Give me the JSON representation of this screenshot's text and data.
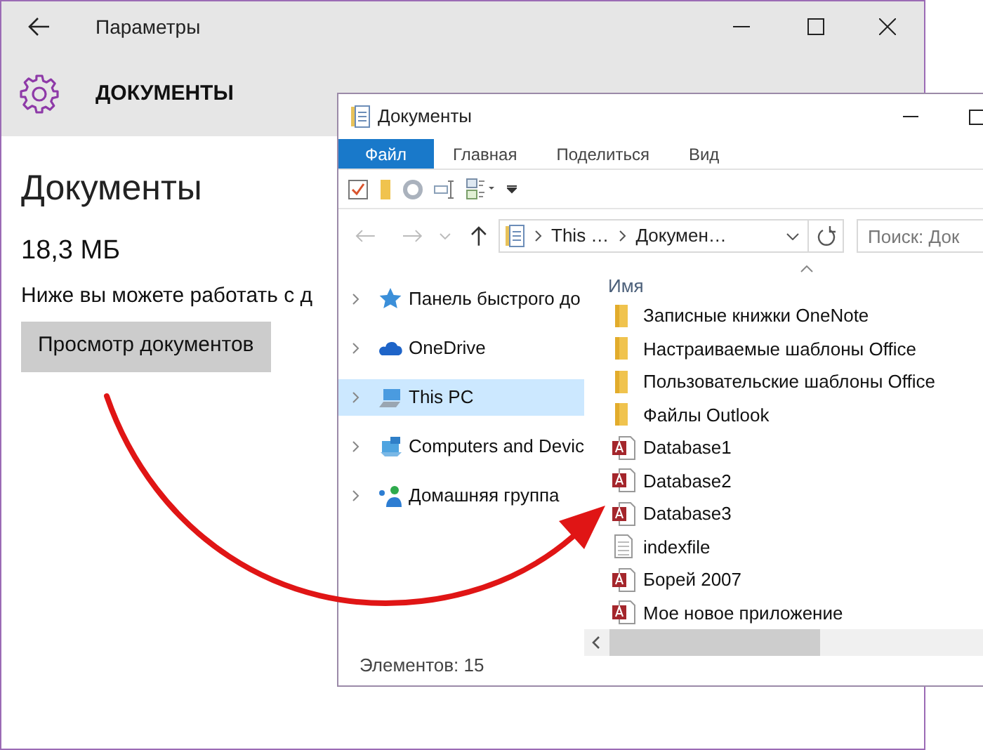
{
  "settings": {
    "title": "Параметры",
    "header": "ДОКУМЕНТЫ",
    "heading": "Документы",
    "size": "18,3 МБ",
    "description": "Ниже вы можете работать с д",
    "button": "Просмотр документов"
  },
  "explorer": {
    "title": "Документы",
    "ribbon_tabs": [
      {
        "label": "Файл",
        "selected": true
      },
      {
        "label": "Главная",
        "selected": false
      },
      {
        "label": "Поделиться",
        "selected": false
      },
      {
        "label": "Вид",
        "selected": false
      }
    ],
    "address": [
      "This …",
      "Докумен…"
    ],
    "search": {
      "placeholder": "Поиск: Док"
    },
    "nav": [
      {
        "label": "Панель быстрого до",
        "kind": "quick",
        "selected": false
      },
      {
        "label": "OneDrive",
        "kind": "cloud",
        "selected": false
      },
      {
        "label": "This PC",
        "kind": "pc",
        "selected": true
      },
      {
        "label": "Computers and Devic",
        "kind": "network",
        "selected": false
      },
      {
        "label": "Домашняя группа",
        "kind": "homegroup",
        "selected": false
      }
    ],
    "column_header": "Имя",
    "files": [
      {
        "name": "Записные книжки OneNote",
        "kind": "folder"
      },
      {
        "name": "Настраиваемые шаблоны Office",
        "kind": "folder"
      },
      {
        "name": "Пользовательские шаблоны Office",
        "kind": "folder"
      },
      {
        "name": "Файлы Outlook",
        "kind": "folder"
      },
      {
        "name": "Database1",
        "kind": "database"
      },
      {
        "name": "Database2",
        "kind": "database"
      },
      {
        "name": "Database3",
        "kind": "database"
      },
      {
        "name": "indexfile",
        "kind": "text"
      },
      {
        "name": "Борей 2007",
        "kind": "database"
      },
      {
        "name": "Мое новое приложение",
        "kind": "database"
      }
    ],
    "status": "Элементов: 15"
  }
}
